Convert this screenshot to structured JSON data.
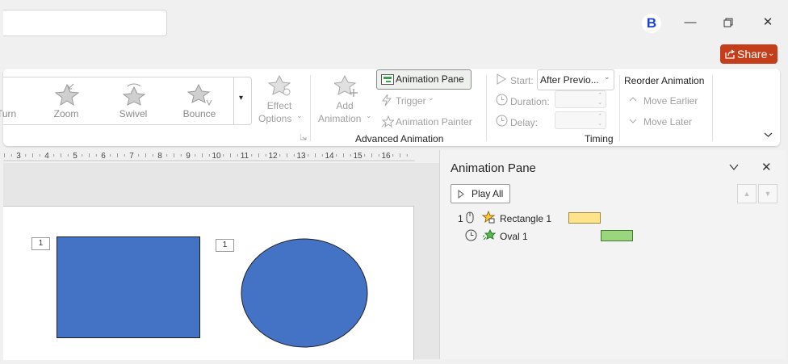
{
  "titlebar": {
    "avatar_initial": "B",
    "minimize_glyph": "—",
    "restore_glyph": "❐",
    "close_glyph": "✕",
    "share_label": "Share",
    "share_caret": "⌄",
    "accent": "#c43e1c"
  },
  "ribbon": {
    "gallery": {
      "items": [
        {
          "label": "Turn",
          "icon": "turn-effect-icon"
        },
        {
          "label": "Zoom",
          "icon": "zoom-effect-icon"
        },
        {
          "label": "Swivel",
          "icon": "swivel-effect-icon"
        },
        {
          "label": "Bounce",
          "icon": "bounce-effect-icon"
        }
      ],
      "more_glyph": "▾"
    },
    "effect_options": {
      "line1": "Effect",
      "line2": "Options",
      "caret": "⌄"
    },
    "add_animation": {
      "line1": "Add",
      "line2": "Animation",
      "caret": "⌄"
    },
    "animation_pane_label": "Animation Pane",
    "trigger_label": "Trigger",
    "trigger_caret": "⌄",
    "animation_painter_label": "Animation Painter",
    "advanced_group_label": "Advanced Animation",
    "start_label": "Start:",
    "start_value": "After Previo...",
    "start_caret": "⌄",
    "duration_label": "Duration:",
    "delay_label": "Delay:",
    "timing_group_label": "Timing",
    "reorder_title": "Reorder Animation",
    "move_earlier_label": "Move Earlier",
    "move_later_label": "Move Later",
    "collapse_glyph": "⌄"
  },
  "ruler": {
    "labels": [
      "3",
      "4",
      "5",
      "6",
      "7",
      "8",
      "9",
      "10",
      "11",
      "12",
      "13",
      "14",
      "15",
      "16"
    ]
  },
  "slide": {
    "rect_tag": "1",
    "oval_tag": "1",
    "shape_fill": "#4472c4"
  },
  "pane": {
    "title": "Animation Pane",
    "collapse_glyph": "⌄",
    "close_glyph": "✕",
    "play_all_label": "Play All",
    "up_glyph": "▲",
    "down_glyph": "▼",
    "items": [
      {
        "number": "1",
        "name": "Rectangle 1",
        "bar_color": "#ffe38a"
      },
      {
        "number": "",
        "name": "Oval 1",
        "bar_color": "#9bd67f"
      }
    ]
  }
}
